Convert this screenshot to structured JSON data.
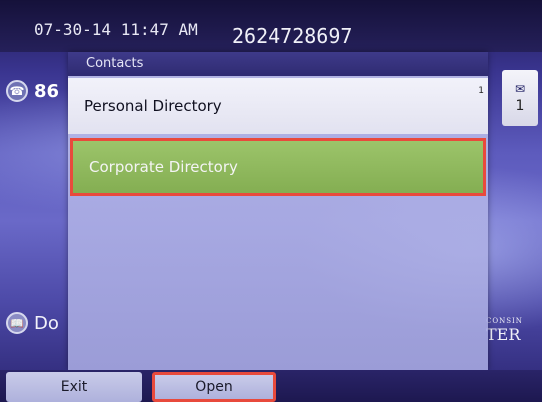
{
  "status_bar": {
    "datetime": "07-30-14 11:47 AM",
    "phone_number": "2624728697"
  },
  "line_key": {
    "icon": "handset-icon",
    "label": "86"
  },
  "messages": {
    "icon": "envelope-icon",
    "count": "1"
  },
  "bottom_left": {
    "icon": "directory-icon",
    "label": "Do"
  },
  "brand": {
    "sub": "CONSIN",
    "main": "TER"
  },
  "contacts": {
    "title": "Contacts",
    "items": [
      {
        "label": "Personal Directory",
        "count": "1"
      },
      {
        "label": "Corporate Directory"
      }
    ],
    "selected_index": 1
  },
  "softkeys": {
    "exit": "Exit",
    "open": "Open"
  },
  "colors": {
    "highlight": "#8ab858",
    "focus_border": "#e84a3c",
    "panel_header": "#2f2b72"
  }
}
